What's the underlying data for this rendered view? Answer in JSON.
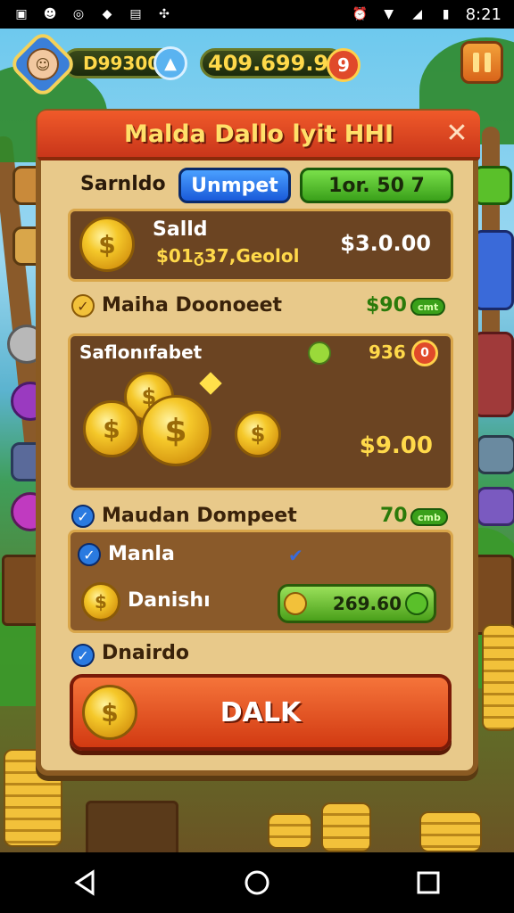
{
  "status_bar": {
    "time": "8:21"
  },
  "hud": {
    "left_value": "D99300",
    "center_value": "409.699.9",
    "plus_symbol": "9"
  },
  "dialog": {
    "title": "Malda Dallo lyit HHI",
    "tabs": {
      "label": "Sarnldo",
      "blue": "Unmpet",
      "green": "1or. 50 7"
    },
    "wallet": {
      "title": "Salld",
      "subtitle": "$01ᵹ37,Geolol",
      "amount": "$3.0.00"
    },
    "row1": {
      "label": "Maiha Doonoeet",
      "value": "$90",
      "badge": "cmt"
    },
    "coins_panel": {
      "title": "Saflonıfabet",
      "count": "936",
      "badge_symbol": "0",
      "amount": "$9.00"
    },
    "row2": {
      "label": "Maudan Dompeet",
      "value": "70",
      "badge": "cmb"
    },
    "detail_panel": {
      "line1": "Manla",
      "line2": "Danishı",
      "pill_value": "269.60"
    },
    "row3": {
      "label": "Dnairdo"
    },
    "button": {
      "label": "DALK"
    }
  },
  "colors": {
    "header": "#e0461f",
    "button": "#e4561f",
    "panel": "#6b4422",
    "parchment": "#e8c98a"
  }
}
